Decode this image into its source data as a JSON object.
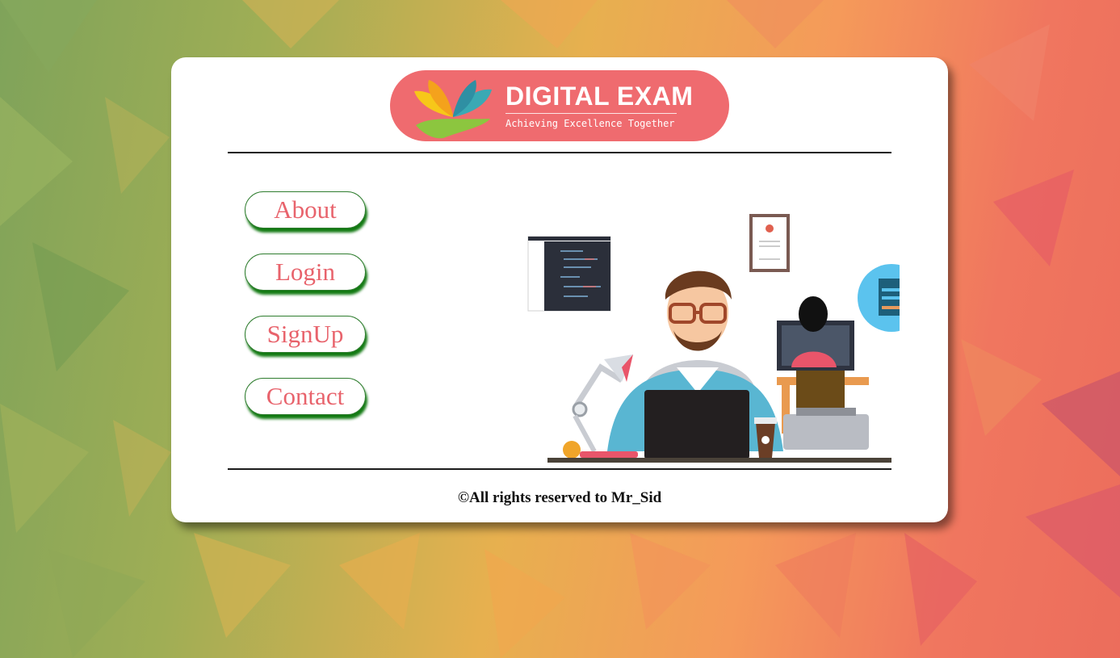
{
  "logo": {
    "title": "DIGITAL EXAM",
    "tagline": "Achieving Excellence Together",
    "bg_color": "#ef6b6f"
  },
  "nav": {
    "items": [
      {
        "label": "About"
      },
      {
        "label": "Login"
      },
      {
        "label": "SignUp"
      },
      {
        "label": "Contact"
      }
    ],
    "text_color": "#e8636c",
    "border_color": "#2f7d2f"
  },
  "illustration": {
    "icon": "developer-workspace-illustration"
  },
  "footer": {
    "text": "©All rights reserved to Mr_Sid"
  }
}
